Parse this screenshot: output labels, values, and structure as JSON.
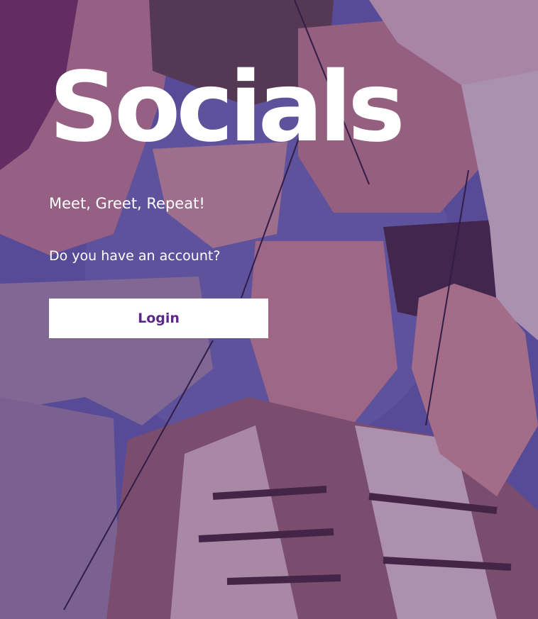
{
  "hero": {
    "title": "Socials",
    "tagline": "Meet, Greet, Repeat!",
    "question": "Do you have an account?",
    "login_label": "Login"
  },
  "colors": {
    "overlay": "#4e206e",
    "button_text": "#5b2a86",
    "button_bg": "#ffffff",
    "text": "#ffffff",
    "sky": "#5a63a8"
  }
}
